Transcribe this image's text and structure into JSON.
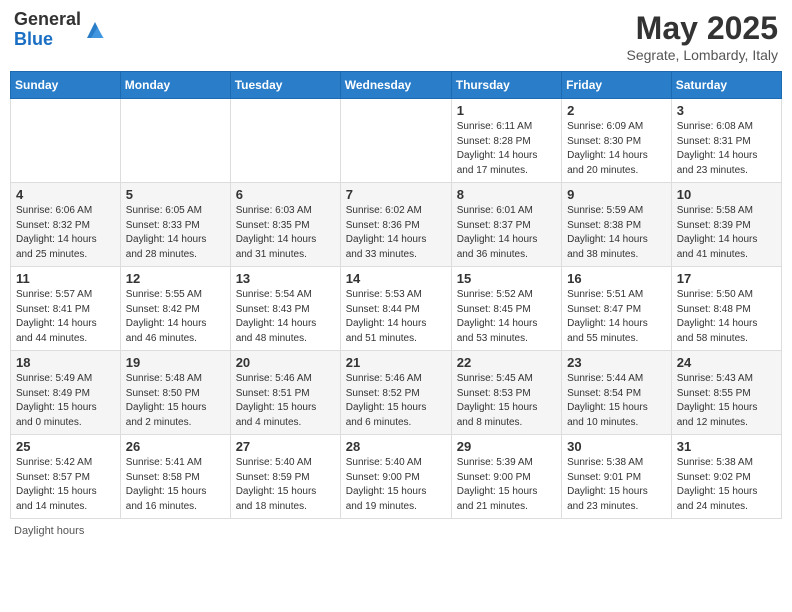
{
  "header": {
    "logo_line1": "General",
    "logo_line2": "Blue",
    "month_title": "May 2025",
    "location": "Segrate, Lombardy, Italy"
  },
  "days_of_week": [
    "Sunday",
    "Monday",
    "Tuesday",
    "Wednesday",
    "Thursday",
    "Friday",
    "Saturday"
  ],
  "weeks": [
    [
      {
        "day": "",
        "info": ""
      },
      {
        "day": "",
        "info": ""
      },
      {
        "day": "",
        "info": ""
      },
      {
        "day": "",
        "info": ""
      },
      {
        "day": "1",
        "info": "Sunrise: 6:11 AM\nSunset: 8:28 PM\nDaylight: 14 hours and 17 minutes."
      },
      {
        "day": "2",
        "info": "Sunrise: 6:09 AM\nSunset: 8:30 PM\nDaylight: 14 hours and 20 minutes."
      },
      {
        "day": "3",
        "info": "Sunrise: 6:08 AM\nSunset: 8:31 PM\nDaylight: 14 hours and 23 minutes."
      }
    ],
    [
      {
        "day": "4",
        "info": "Sunrise: 6:06 AM\nSunset: 8:32 PM\nDaylight: 14 hours and 25 minutes."
      },
      {
        "day": "5",
        "info": "Sunrise: 6:05 AM\nSunset: 8:33 PM\nDaylight: 14 hours and 28 minutes."
      },
      {
        "day": "6",
        "info": "Sunrise: 6:03 AM\nSunset: 8:35 PM\nDaylight: 14 hours and 31 minutes."
      },
      {
        "day": "7",
        "info": "Sunrise: 6:02 AM\nSunset: 8:36 PM\nDaylight: 14 hours and 33 minutes."
      },
      {
        "day": "8",
        "info": "Sunrise: 6:01 AM\nSunset: 8:37 PM\nDaylight: 14 hours and 36 minutes."
      },
      {
        "day": "9",
        "info": "Sunrise: 5:59 AM\nSunset: 8:38 PM\nDaylight: 14 hours and 38 minutes."
      },
      {
        "day": "10",
        "info": "Sunrise: 5:58 AM\nSunset: 8:39 PM\nDaylight: 14 hours and 41 minutes."
      }
    ],
    [
      {
        "day": "11",
        "info": "Sunrise: 5:57 AM\nSunset: 8:41 PM\nDaylight: 14 hours and 44 minutes."
      },
      {
        "day": "12",
        "info": "Sunrise: 5:55 AM\nSunset: 8:42 PM\nDaylight: 14 hours and 46 minutes."
      },
      {
        "day": "13",
        "info": "Sunrise: 5:54 AM\nSunset: 8:43 PM\nDaylight: 14 hours and 48 minutes."
      },
      {
        "day": "14",
        "info": "Sunrise: 5:53 AM\nSunset: 8:44 PM\nDaylight: 14 hours and 51 minutes."
      },
      {
        "day": "15",
        "info": "Sunrise: 5:52 AM\nSunset: 8:45 PM\nDaylight: 14 hours and 53 minutes."
      },
      {
        "day": "16",
        "info": "Sunrise: 5:51 AM\nSunset: 8:47 PM\nDaylight: 14 hours and 55 minutes."
      },
      {
        "day": "17",
        "info": "Sunrise: 5:50 AM\nSunset: 8:48 PM\nDaylight: 14 hours and 58 minutes."
      }
    ],
    [
      {
        "day": "18",
        "info": "Sunrise: 5:49 AM\nSunset: 8:49 PM\nDaylight: 15 hours and 0 minutes."
      },
      {
        "day": "19",
        "info": "Sunrise: 5:48 AM\nSunset: 8:50 PM\nDaylight: 15 hours and 2 minutes."
      },
      {
        "day": "20",
        "info": "Sunrise: 5:46 AM\nSunset: 8:51 PM\nDaylight: 15 hours and 4 minutes."
      },
      {
        "day": "21",
        "info": "Sunrise: 5:46 AM\nSunset: 8:52 PM\nDaylight: 15 hours and 6 minutes."
      },
      {
        "day": "22",
        "info": "Sunrise: 5:45 AM\nSunset: 8:53 PM\nDaylight: 15 hours and 8 minutes."
      },
      {
        "day": "23",
        "info": "Sunrise: 5:44 AM\nSunset: 8:54 PM\nDaylight: 15 hours and 10 minutes."
      },
      {
        "day": "24",
        "info": "Sunrise: 5:43 AM\nSunset: 8:55 PM\nDaylight: 15 hours and 12 minutes."
      }
    ],
    [
      {
        "day": "25",
        "info": "Sunrise: 5:42 AM\nSunset: 8:57 PM\nDaylight: 15 hours and 14 minutes."
      },
      {
        "day": "26",
        "info": "Sunrise: 5:41 AM\nSunset: 8:58 PM\nDaylight: 15 hours and 16 minutes."
      },
      {
        "day": "27",
        "info": "Sunrise: 5:40 AM\nSunset: 8:59 PM\nDaylight: 15 hours and 18 minutes."
      },
      {
        "day": "28",
        "info": "Sunrise: 5:40 AM\nSunset: 9:00 PM\nDaylight: 15 hours and 19 minutes."
      },
      {
        "day": "29",
        "info": "Sunrise: 5:39 AM\nSunset: 9:00 PM\nDaylight: 15 hours and 21 minutes."
      },
      {
        "day": "30",
        "info": "Sunrise: 5:38 AM\nSunset: 9:01 PM\nDaylight: 15 hours and 23 minutes."
      },
      {
        "day": "31",
        "info": "Sunrise: 5:38 AM\nSunset: 9:02 PM\nDaylight: 15 hours and 24 minutes."
      }
    ]
  ],
  "footer": {
    "text": "Daylight hours"
  }
}
